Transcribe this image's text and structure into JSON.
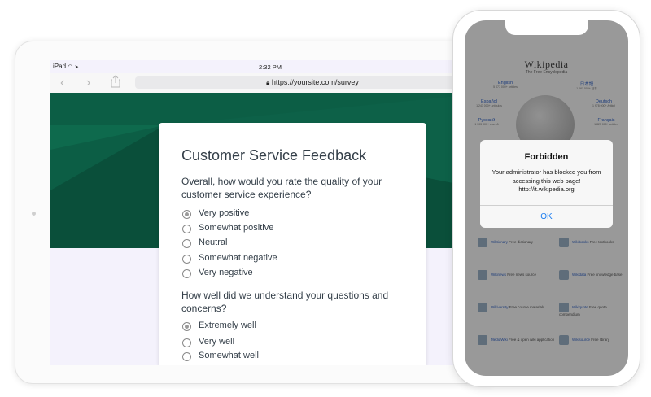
{
  "ipad": {
    "status": {
      "carrier": "iPad",
      "time": "2:32 PM"
    },
    "url": "https://yoursite.com/survey",
    "survey": {
      "title": "Customer Service Feedback",
      "questions": [
        {
          "text": "Overall, how would you rate the quality of your customer service experience?",
          "options": [
            "Very positive",
            "Somewhat positive",
            "Neutral",
            "Somewhat negative",
            "Very negative"
          ],
          "selected": "Very positive"
        },
        {
          "text": "How well did we understand your questions and concerns?",
          "options": [
            "Extremely well",
            "Very well",
            "Somewhat well"
          ],
          "selected": "Extremely well"
        }
      ]
    },
    "colors": {
      "hero": "#0c5e45",
      "background": "#f4f2fc"
    }
  },
  "iphone": {
    "background_page": {
      "title": "Wikipedia",
      "subtitle": "The Free Encyclopedia",
      "languages": [
        {
          "name": "English",
          "count": "5 077 000+ articles"
        },
        {
          "name": "日本語",
          "count": "1 061 000+ 記事"
        },
        {
          "name": "Español",
          "count": "1 243 000+ artículos"
        },
        {
          "name": "Deutsch",
          "count": "1 978 000+ Artikel"
        },
        {
          "name": "Русский",
          "count": "1 303 000+ статей"
        },
        {
          "name": "Français",
          "count": "1 825 000+ articles"
        }
      ],
      "sister_projects": [
        {
          "name": "Wiktionary",
          "desc": "Free dictionary"
        },
        {
          "name": "Wikibooks",
          "desc": "Free textbooks"
        },
        {
          "name": "Wikinews",
          "desc": "Free news source"
        },
        {
          "name": "Wikidata",
          "desc": "Free knowledge base"
        },
        {
          "name": "Wikiversity",
          "desc": "Free course materials"
        },
        {
          "name": "Wikiquote",
          "desc": "Free quote compendium"
        },
        {
          "name": "MediaWiki",
          "desc": "Free & open wiki application"
        },
        {
          "name": "Wikisource",
          "desc": "Free library"
        }
      ]
    },
    "alert": {
      "title": "Forbidden",
      "message": "Your administrator has blocked you from accessing this web page! http://it.wikipedia.org",
      "ok": "OK"
    }
  }
}
